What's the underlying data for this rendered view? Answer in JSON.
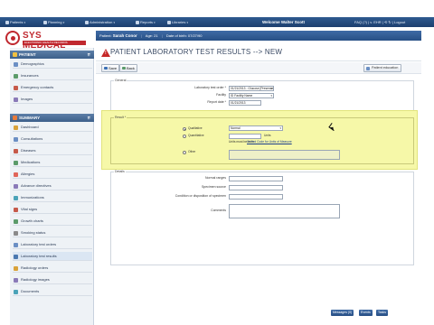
{
  "topnav": {
    "items": [
      {
        "label": "Patients",
        "icon": "person-icon"
      },
      {
        "label": "Planning",
        "icon": "calendar-icon"
      },
      {
        "label": "Administration",
        "icon": "gear-icon"
      },
      {
        "label": "Reports",
        "icon": "chart-icon"
      },
      {
        "label": "Libraries",
        "icon": "book-icon"
      }
    ],
    "welcome_text": "Welcome Walter Scott",
    "right_text": "FAQ (?)  |  v. EHR  |  ⟲ ↻  |  Logout"
  },
  "logo": {
    "name": "SYS MEDICAL",
    "tagline": "ELECTRONIC HEALTH RECORDS"
  },
  "patient_bar": {
    "label": "Patient:",
    "name": "Sarah Conor",
    "age": "Age: 21",
    "dob": "Date of birth: 07/27/90"
  },
  "sidebar": {
    "patient_header": "PATIENT",
    "patient_items": [
      "Demographics",
      "Insurances",
      "Emergency contacts",
      "Images"
    ],
    "summary_header": "SUMMARY",
    "summary_items": [
      "Dashboard",
      "Consultations",
      "Diseases",
      "Medications",
      "Allergies",
      "Advance directives",
      "Immunizations",
      "Vital signs",
      "Growth charts",
      "Smoking status",
      "Laboratory test orders",
      "Laboratory test results",
      "Radiology orders",
      "Radiology images",
      "Documents"
    ]
  },
  "page": {
    "title": "PATIENT LABORATORY TEST RESULTS --> NEW"
  },
  "toolbar": {
    "save_label": "Save",
    "back_label": "Back",
    "patient_education_label": "Patient education"
  },
  "form": {
    "general_legend": "General",
    "lab_test_order_label": "Laboratory test order *",
    "lab_test_order_value": "01/21/2013 - Glucose [Presence] in Urine",
    "facility_label": "Facility",
    "facility_value": "ID Facility Name",
    "report_date_label": "Report date *",
    "report_date_value": "01/21/2013",
    "result_legend": "Result *",
    "qualitative_label": "Qualitative",
    "qualitative_value": "Normal",
    "quantitative_label": "Quantitative",
    "units_label": "Units",
    "units_hint_prefix": "Units must be from",
    "units_link": "Unified Code for Units of Measure",
    "other_label": "Other",
    "details_legend": "Details",
    "normal_ranges_label": "Normal ranges",
    "specimen_source_label": "Specimen source",
    "specimen_condition_label": "Condition or disposition of specimen",
    "comments_label": "Comments"
  },
  "status_bar": {
    "messages": "Messages (0)",
    "events": "Events",
    "tasks": "Tasks"
  },
  "colors": {
    "nav_blue": "#284f85",
    "brand_red": "#c0282f",
    "highlight_yellow": "#f6f8a8",
    "warning_red": "#c62828"
  }
}
